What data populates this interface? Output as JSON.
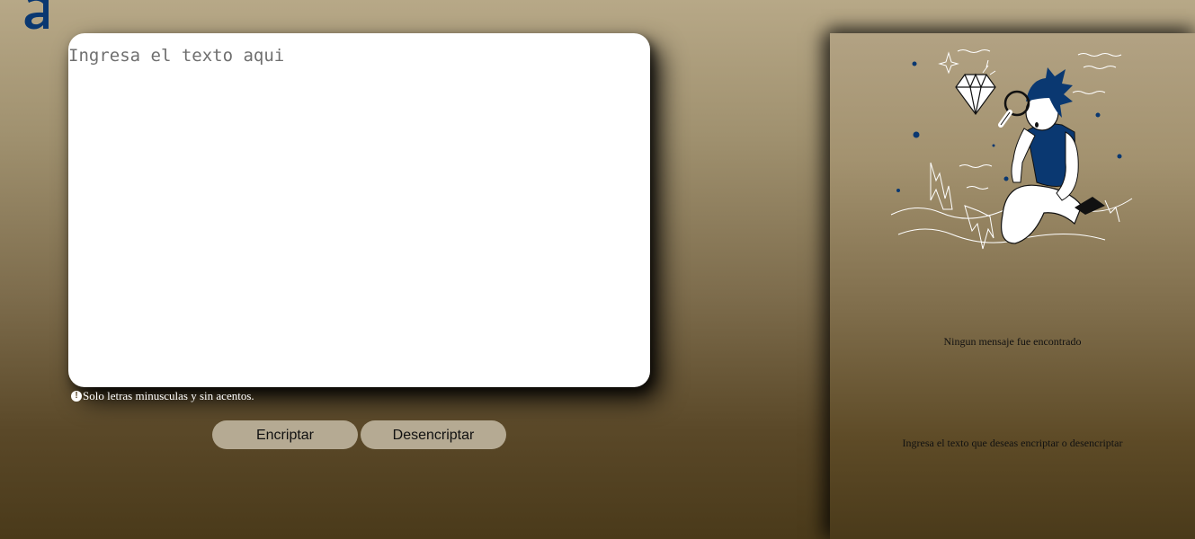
{
  "brand": {
    "logo_icon": "alura-a-logo-icon",
    "color": "#0a3871"
  },
  "editor": {
    "placeholder": "Ingresa el texto aqui",
    "value": ""
  },
  "hint": {
    "icon": "info-icon",
    "text": "Solo letras minusculas y sin acentos."
  },
  "actions": {
    "encrypt_label": "Encriptar",
    "decrypt_label": "Desencriptar"
  },
  "output_panel": {
    "illustration": "person-with-magnifier-illustration",
    "title": "Ningun mensaje fue encontrado",
    "subtitle": "Ingresa el texto que deseas encriptar o desencriptar"
  }
}
